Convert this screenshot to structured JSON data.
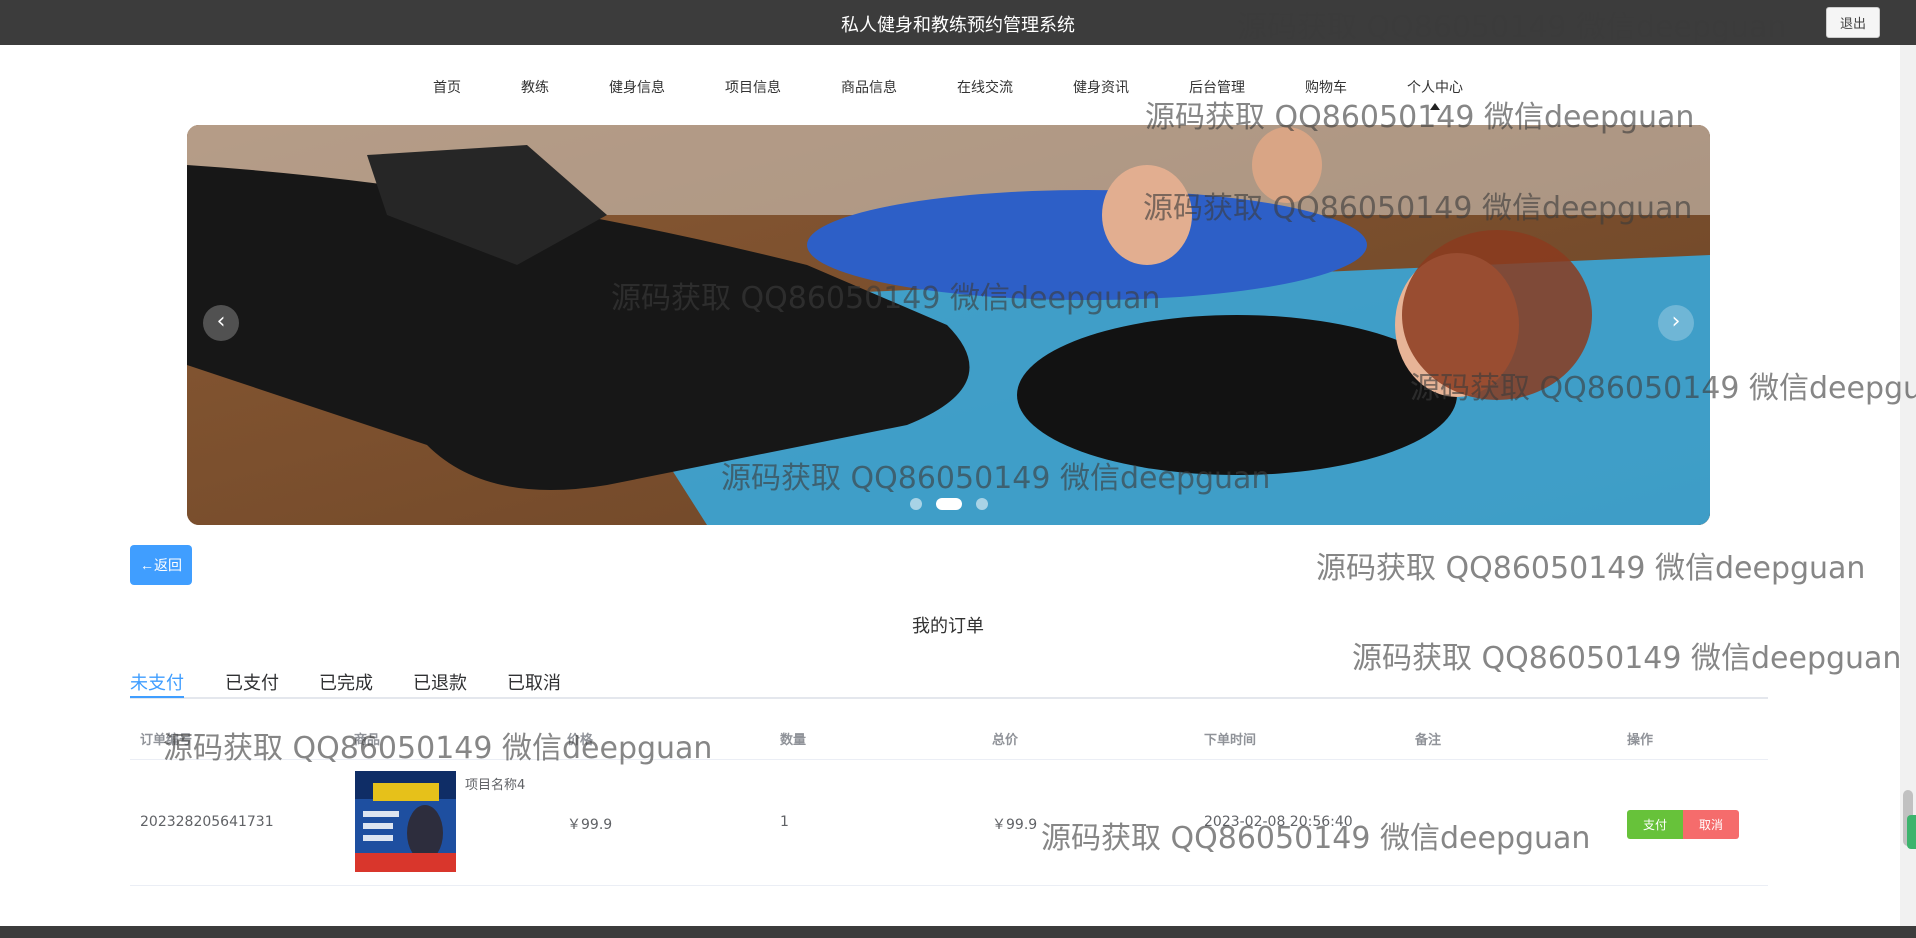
{
  "header": {
    "title": "私人健身和教练预约管理系统",
    "logout_label": "退出"
  },
  "nav": {
    "items": [
      "首页",
      "教练",
      "健身信息",
      "项目信息",
      "商品信息",
      "在线交流",
      "健身资讯",
      "后台管理",
      "购物车",
      "个人中心"
    ]
  },
  "carousel": {
    "prev_icon": "chevron-left-icon",
    "prev_glyph": "‹",
    "next_icon": "chevron-right-icon",
    "next_glyph": "›",
    "slide_count": 3,
    "active_slide": 2
  },
  "back_button": {
    "label": "←返回"
  },
  "section_title": "我的订单",
  "tabs": [
    "未支付",
    "已支付",
    "已完成",
    "已退款",
    "已取消"
  ],
  "active_tab": 0,
  "orders": {
    "columns": [
      "订单编号",
      "商品",
      "价格",
      "数量",
      "总价",
      "下单时间",
      "备注",
      "操作"
    ],
    "rows": [
      {
        "order_no": "202328205641731",
        "product_name": "项目名称4",
        "price": "￥99.9",
        "quantity": "1",
        "total": "￥99.9",
        "time": "2023-02-08 20:56:40",
        "remark": "",
        "pay_label": "支付",
        "cancel_label": "取消"
      }
    ]
  },
  "watermark": "源码获取 QQ86050149 微信deepguan",
  "colors": {
    "topbar": "#3c3c3c",
    "primary": "#409eff",
    "success": "#67c23a",
    "danger": "#f56c6c"
  }
}
